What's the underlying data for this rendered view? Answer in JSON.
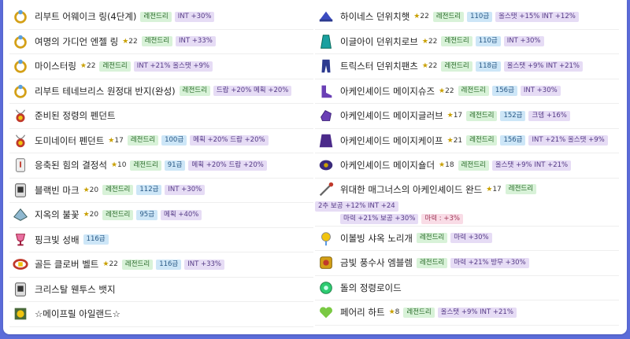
{
  "colors": {
    "legendary_bg": "#d8f2d8",
    "level_bg": "#cde6f7",
    "option_bg": "#e6dcf5",
    "pink_bg": "#f9dce6",
    "page_bg": "#5b6cd9"
  },
  "left": [
    {
      "name": "리부트 어웨이크 링(4단계)",
      "icon": "ring-icon",
      "star": "",
      "grade": "레전드리",
      "level": "",
      "options": [
        "INT +30%"
      ],
      "pink": ""
    },
    {
      "name": "여명의 가디언 엔젤 링",
      "icon": "ring-icon",
      "star": "22",
      "grade": "레전드리",
      "level": "",
      "options": [
        "INT +33%"
      ],
      "pink": ""
    },
    {
      "name": "마이스터링",
      "icon": "ring-icon",
      "star": "22",
      "grade": "레전드리",
      "level": "",
      "options": [
        "INT +21% 올스탯 +9%"
      ],
      "pink": ""
    },
    {
      "name": "리부트 테네브리스 원정대 반지(완성)",
      "icon": "ring-icon",
      "star": "",
      "grade": "레전드리",
      "level": "",
      "options": [
        "드랍 +20% 메획 +20%"
      ],
      "pink": ""
    },
    {
      "name": "준비된 정령의 펜던트",
      "icon": "pendant-icon",
      "star": "",
      "grade": "",
      "level": "",
      "options": [],
      "pink": ""
    },
    {
      "name": "도미네이터 펜던트",
      "icon": "pendant-icon",
      "star": "17",
      "grade": "레전드리",
      "level": "100급",
      "options": [
        "메획 +20% 드랍 +20%"
      ],
      "pink": ""
    },
    {
      "name": "응축된 힘의 결정석",
      "icon": "pocket-icon",
      "star": "10",
      "grade": "레전드리",
      "level": "91급",
      "options": [
        "메획 +20% 드랍 +20%"
      ],
      "pink": ""
    },
    {
      "name": "블랙빈 마크",
      "icon": "badge-icon",
      "star": "20",
      "grade": "레전드리",
      "level": "112급",
      "options": [
        "INT +30%"
      ],
      "pink": ""
    },
    {
      "name": "지옥의 불꽃",
      "icon": "eye-accessory-icon",
      "star": "20",
      "grade": "레전드리",
      "level": "95급",
      "options": [
        "메획 +40%"
      ],
      "pink": ""
    },
    {
      "name": "핑크빛 성배",
      "icon": "grail-icon",
      "star": "",
      "grade": "",
      "level": "116급",
      "options": [],
      "pink": ""
    },
    {
      "name": "골든 클로버 벨트",
      "icon": "belt-icon",
      "star": "22",
      "grade": "레전드리",
      "level": "116급",
      "options": [
        "INT +33%"
      ],
      "pink": ""
    },
    {
      "name": "크리스탈 웬투스 뱃지",
      "icon": "badge-icon",
      "star": "",
      "grade": "",
      "level": "",
      "options": [],
      "pink": ""
    },
    {
      "name": "☆메이프릴 아일랜드☆",
      "icon": "medal-icon",
      "star": "",
      "grade": "",
      "level": "",
      "options": [],
      "pink": ""
    }
  ],
  "right": [
    {
      "name": "하이네스 던위치햇",
      "icon": "hat-icon",
      "star": "22",
      "grade": "레전드리",
      "level": "110급",
      "options": [
        "올스탯 +15% INT +12%"
      ],
      "pink": ""
    },
    {
      "name": "이글아이 던위치로브",
      "icon": "robe-icon",
      "star": "22",
      "grade": "레전드리",
      "level": "110급",
      "options": [
        "INT +30%"
      ],
      "pink": ""
    },
    {
      "name": "트릭스터 던위치팬츠",
      "icon": "pants-icon",
      "star": "22",
      "grade": "레전드리",
      "level": "118급",
      "options": [
        "올스탯 +9% INT +21%"
      ],
      "pink": ""
    },
    {
      "name": "아케인셰이드 메이지슈즈",
      "icon": "shoes-icon",
      "star": "22",
      "grade": "레전드리",
      "level": "156급",
      "options": [
        "INT +30%"
      ],
      "pink": ""
    },
    {
      "name": "아케인셰이드 메이지글러브",
      "icon": "glove-icon",
      "star": "17",
      "grade": "레전드리",
      "level": "152급",
      "options": [
        "크뎀 +16%"
      ],
      "pink": ""
    },
    {
      "name": "아케인셰이드 메이지케이프",
      "icon": "cape-icon",
      "star": "21",
      "grade": "레전드리",
      "level": "156급",
      "options": [
        "INT +21% 올스탯 +9%"
      ],
      "pink": ""
    },
    {
      "name": "아케인셰이드 메이지숄더",
      "icon": "shoulder-icon",
      "star": "18",
      "grade": "레전드리",
      "level": "",
      "options": [
        "올스탯 +9% INT +21%"
      ],
      "pink": ""
    },
    {
      "name": "위대한 매그너스의 아케인셰이드 완드",
      "icon": "wand-icon",
      "star": "17",
      "grade": "레전드리",
      "level": "",
      "options": [
        "2추 보공 +12% INT +24"
      ],
      "wrap": [
        "마력 +21% 보공 +30%"
      ],
      "pink": "마력 : +3%"
    },
    {
      "name": "이볼빙 샤옥 노리개",
      "icon": "secondary-icon",
      "star": "",
      "grade": "레전드리",
      "level": "",
      "options": [
        "마력 +30%"
      ],
      "pink": ""
    },
    {
      "name": "금빛 풍수사 엠블렘",
      "icon": "emblem-icon",
      "star": "",
      "grade": "레전드리",
      "level": "",
      "options": [
        "마력 +21% 방무 +30%"
      ],
      "pink": ""
    },
    {
      "name": "돌의 정령로이드",
      "icon": "android-icon",
      "star": "",
      "grade": "",
      "level": "",
      "options": [],
      "pink": ""
    },
    {
      "name": "페어리 하트",
      "icon": "heart-icon",
      "star": "8",
      "grade": "레전드리",
      "level": "",
      "options": [
        "올스탯 +9% INT +21%"
      ],
      "pink": ""
    }
  ]
}
